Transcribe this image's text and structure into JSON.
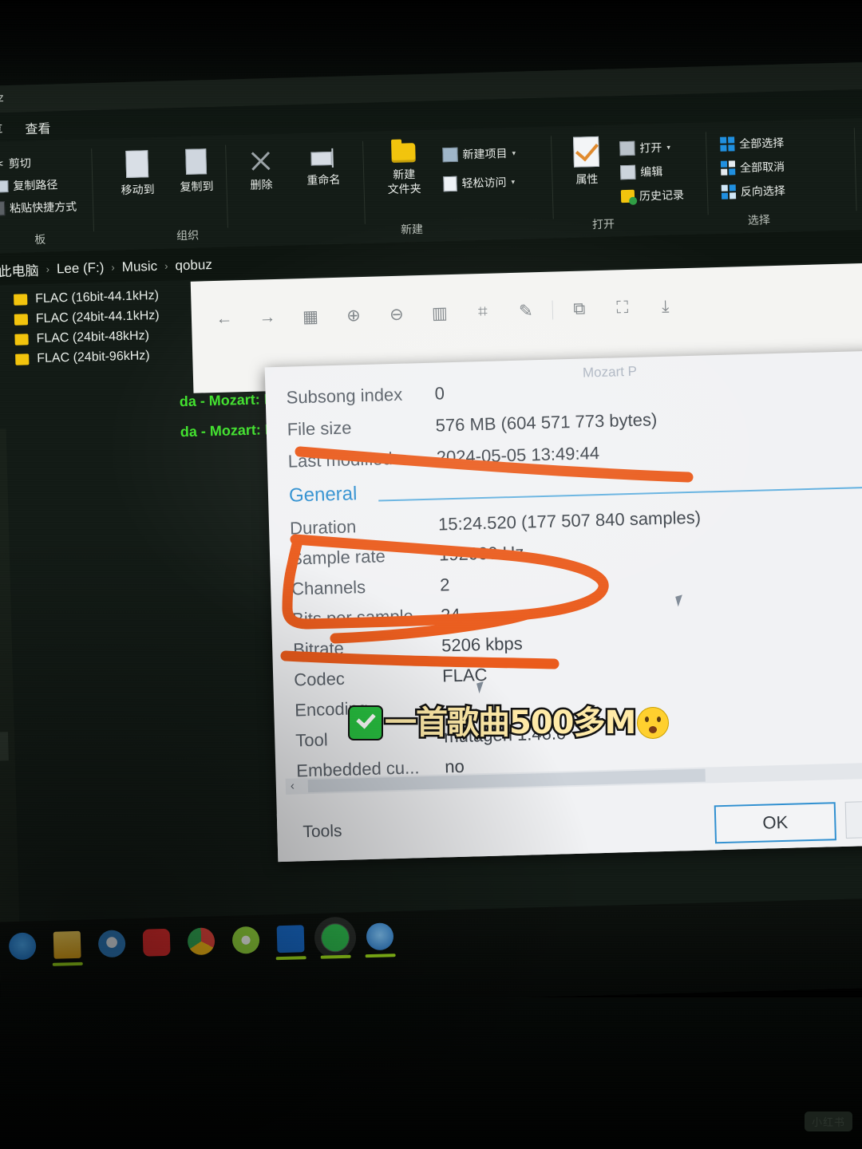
{
  "window": {
    "title": "uz",
    "menu": [
      {
        "label": "共享"
      },
      {
        "label": "查看"
      }
    ]
  },
  "ribbon": {
    "groups": [
      {
        "label": "板",
        "items": [
          {
            "label": "剪切",
            "icon": "scissors-icon"
          },
          {
            "label": "复制路径",
            "icon": "copy-path-icon"
          },
          {
            "label": "粘贴快捷方式",
            "icon": "paste-shortcut-icon"
          }
        ]
      },
      {
        "label": "组织",
        "items": [
          {
            "label": "移动到",
            "icon": "move-to-icon"
          },
          {
            "label": "复制到",
            "icon": "copy-to-icon"
          },
          {
            "label": "删除",
            "icon": "delete-icon"
          },
          {
            "label": "重命名",
            "icon": "rename-icon"
          }
        ]
      },
      {
        "label": "新建",
        "items": [
          {
            "label": "新建\n文件夹",
            "label_line1": "新建",
            "label_line2": "文件夹",
            "icon": "new-folder-icon"
          },
          {
            "label": "新建项目",
            "icon": "new-item-icon"
          },
          {
            "label": "轻松访问",
            "icon": "easy-access-icon"
          }
        ]
      },
      {
        "label": "打开",
        "items": [
          {
            "label": "属性",
            "icon": "properties-icon"
          },
          {
            "label": "打开",
            "icon": "open-icon"
          },
          {
            "label": "编辑",
            "icon": "edit-icon"
          },
          {
            "label": "历史记录",
            "icon": "history-icon"
          }
        ]
      },
      {
        "label": "选择",
        "items": [
          {
            "label": "全部选择",
            "icon": "select-all-icon"
          },
          {
            "label": "全部取消",
            "icon": "select-none-icon"
          },
          {
            "label": "反向选择",
            "icon": "invert-selection-icon"
          }
        ]
      }
    ]
  },
  "breadcrumb": {
    "items": [
      "此电脑",
      "Lee (F:)",
      "Music",
      "qobuz"
    ]
  },
  "file_list": {
    "items": [
      {
        "name": "FLAC (16bit-44.1kHz)"
      },
      {
        "name": "FLAC (24bit-44.1kHz)"
      },
      {
        "name": "FLAC (24bit-48kHz)"
      },
      {
        "name": "FLAC (24bit-96kHz)"
      }
    ]
  },
  "playlist_rows": [
    {
      "text": "da - Mozart: Pi"
    },
    {
      "text": "da - Mozart: Pi"
    }
  ],
  "viewer_toolbar": {
    "buttons": [
      {
        "icon": "back-arrow-icon",
        "glyph": "←"
      },
      {
        "icon": "forward-arrow-icon",
        "glyph": "→"
      },
      {
        "icon": "grid-view-icon",
        "glyph": "▦"
      },
      {
        "icon": "zoom-in-icon",
        "glyph": "⊕"
      },
      {
        "icon": "zoom-out-icon",
        "glyph": "⊖"
      },
      {
        "icon": "fit-width-icon",
        "glyph": "▥"
      },
      {
        "icon": "crop-icon",
        "glyph": "⌗"
      },
      {
        "icon": "edit-icon",
        "glyph": "✎"
      },
      {
        "icon": "rotate-icon",
        "glyph": "⧉"
      },
      {
        "icon": "transform-icon",
        "glyph": "⛶"
      },
      {
        "icon": "save-icon",
        "glyph": "⤓"
      }
    ]
  },
  "dialog": {
    "ghost_title": "Mozart P",
    "properties": [
      {
        "key": "Subsong index",
        "value": "0"
      },
      {
        "key": "File size",
        "value": "576 MB (604 571 773 bytes)"
      },
      {
        "key": "Last modified",
        "value": "2024-05-05 13:49:44"
      }
    ],
    "section": {
      "title": "General"
    },
    "general": [
      {
        "key": "Duration",
        "value": "15:24.520 (177 507 840 samples)"
      },
      {
        "key": "Sample rate",
        "value": "192000 Hz"
      },
      {
        "key": "Channels",
        "value": "2"
      },
      {
        "key": "Bits per sample",
        "value": "24"
      },
      {
        "key": "Bitrate",
        "value": "5206 kbps"
      },
      {
        "key": "Codec",
        "value": "FLAC"
      },
      {
        "key": "Encoding",
        "value": ""
      },
      {
        "key": "Tool",
        "value": "mutagen 1.46.0"
      },
      {
        "key": "Embedded cu...",
        "value": "no"
      }
    ],
    "footer": {
      "tools_label": "Tools",
      "ok_label": "OK"
    },
    "scroll_arrow": "‹"
  },
  "caption": {
    "text": "一首歌曲500多M",
    "check_icon": "white-check-mark-emoji",
    "face_icon": "hushed-face-emoji"
  },
  "taskbar": {
    "items": [
      {
        "name": "cortana",
        "color": "#1e7fd6",
        "running": false
      },
      {
        "name": "file-explorer",
        "color": "#f3c033",
        "running": true
      },
      {
        "name": "clock-app",
        "color": "#2f7fc4",
        "running": false
      },
      {
        "name": "netease-music",
        "color": "#e02c2c",
        "running": false
      },
      {
        "name": "chrome",
        "color": "#e8eaed",
        "running": false
      },
      {
        "name": "internet-explorer",
        "color": "#8fd13a",
        "running": false
      },
      {
        "name": "upload-tool",
        "color": "#1667c4",
        "running": true
      },
      {
        "name": "wechat",
        "color": "#2bb34a",
        "running": true
      },
      {
        "name": "sogou-browser",
        "color": "#2a86d8",
        "running": true
      }
    ]
  },
  "watermark": {
    "text": "小红书"
  },
  "colors": {
    "marker": "#ea5a1a",
    "section_blue": "#2f8fd0",
    "caption_fill": "#ffeaa7",
    "folder_yellow": "#f2c40c",
    "playlist_green": "#3ee02a"
  }
}
